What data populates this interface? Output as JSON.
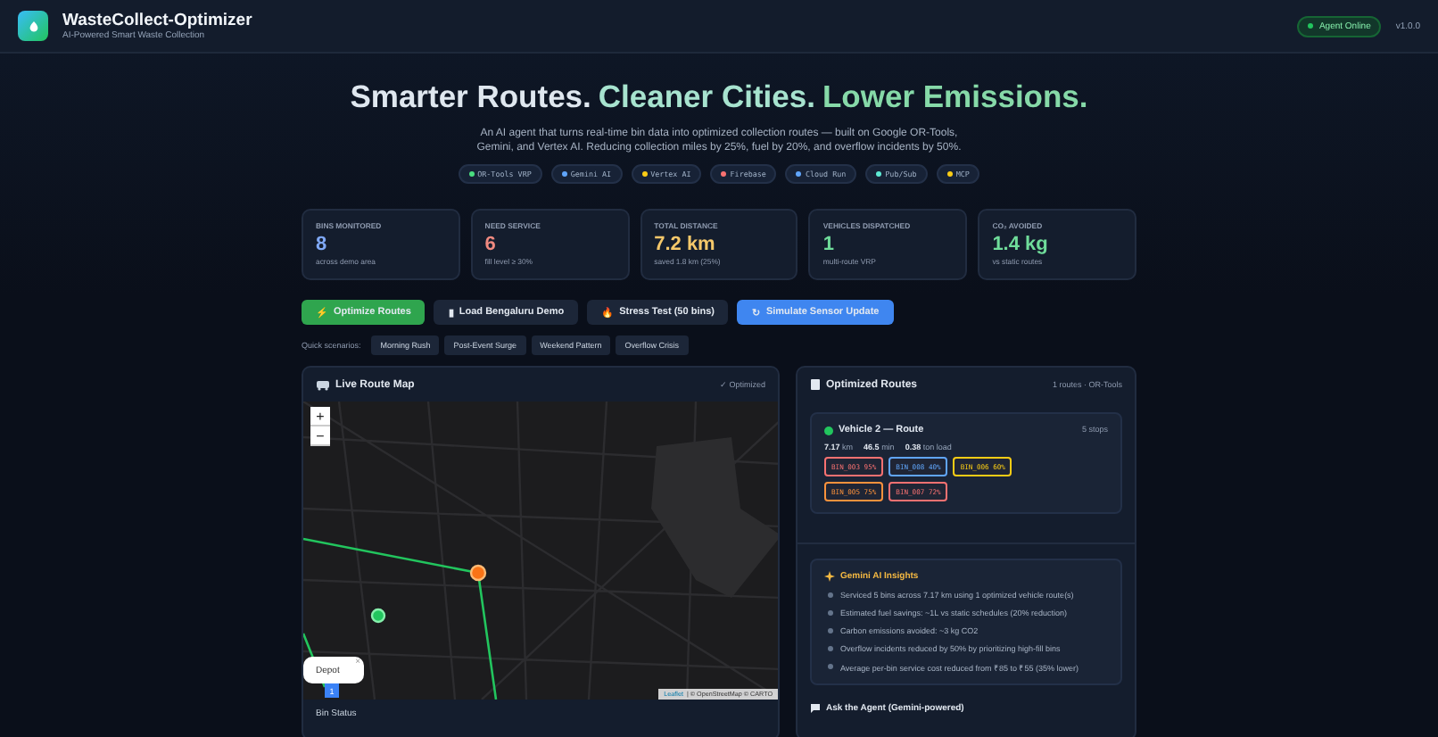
{
  "header": {
    "title": "WasteCollect-Optimizer",
    "subtitle": "AI-Powered Smart Waste Collection",
    "status": "Agent Online",
    "version": "v1.0.0"
  },
  "hero": {
    "title_parts": [
      {
        "text": "Smarter Routes.",
        "color": "#dfe7ef"
      },
      {
        "text": "Cleaner Cities.",
        "color": "#a7e3cf"
      },
      {
        "text": "Lower Emissions.",
        "color": "#86d9a8"
      }
    ],
    "description": "An AI agent that turns real-time bin data into optimized collection routes — built on Google OR-Tools, Gemini, and Vertex AI. Reducing collection miles by 25%, fuel by 20%, and overflow incidents by 50%.",
    "tech_chips": [
      {
        "label": "OR-Tools VRP",
        "color": "#4ade80"
      },
      {
        "label": "Gemini AI",
        "color": "#60a5fa"
      },
      {
        "label": "Vertex AI",
        "color": "#facc15"
      },
      {
        "label": "Firebase",
        "color": "#f87171"
      },
      {
        "label": "Cloud Run",
        "color": "#60a5fa"
      },
      {
        "label": "Pub/Sub",
        "color": "#5eead4"
      },
      {
        "label": "MCP",
        "color": "#facc15"
      }
    ]
  },
  "stats": [
    {
      "label": "BINS MONITORED",
      "value": "8",
      "note": "across demo area",
      "color": "#7fa8f5"
    },
    {
      "label": "NEED SERVICE",
      "value": "6",
      "note": "fill level ≥ 30%",
      "color": "#f08a80"
    },
    {
      "label": "TOTAL DISTANCE",
      "value": "7.2 km",
      "note": "saved 1.8 km (25%)",
      "color": "#f5c86a"
    },
    {
      "label": "VEHICLES DISPATCHED",
      "value": "1",
      "note": "multi-route VRP",
      "color": "#6fdc9a"
    },
    {
      "label": "CO₂ AVOIDED",
      "value": "1.4 kg",
      "note": "vs static routes",
      "color": "#6fdc9a"
    }
  ],
  "actions": [
    {
      "label": "Optimize Routes",
      "icon": "⚡",
      "kind": "success"
    },
    {
      "label": "Load Bengaluru Demo",
      "icon": "▮",
      "kind": "plain"
    },
    {
      "label": "Stress Test (50 bins)",
      "icon": "🔥",
      "kind": "plain"
    },
    {
      "label": "Simulate Sensor Update",
      "icon": "↻",
      "kind": "primary"
    }
  ],
  "quick_scenarios": {
    "label": "Quick scenarios:",
    "items": [
      "Morning Rush",
      "Post-Event Surge",
      "Weekend Pattern",
      "Overflow Crisis"
    ]
  },
  "map_panel": {
    "title": "Live Route Map",
    "status": "✓ Optimized",
    "zoom_in": "+",
    "zoom_out": "−",
    "popup": "Depot",
    "popup_close": "×",
    "depot_marker": "1",
    "attribution_link": "Leaflet",
    "attribution": "| © OpenStreetMap © CARTO",
    "footer": "Bin Status"
  },
  "routes_panel": {
    "title": "Optimized Routes",
    "meta": "1 routes · OR-Tools",
    "route": {
      "name": "Vehicle 2 — Route",
      "stops": "5 stops",
      "distance_value": "7.17",
      "distance_unit": "km",
      "time_value": "46.5",
      "time_unit": "min",
      "load_value": "0.38",
      "load_unit": "ton load",
      "bins": [
        {
          "label": "BIN_003 95%",
          "color": "#f87171"
        },
        {
          "label": "BIN_008 40%",
          "color": "#60a5fa"
        },
        {
          "label": "BIN_006 60%",
          "color": "#facc15"
        },
        {
          "label": "BIN_005 75%",
          "color": "#fb923c"
        },
        {
          "label": "BIN_007 72%",
          "color": "#f87171"
        }
      ]
    },
    "insights": {
      "title": "Gemini AI Insights",
      "items": [
        "Serviced 5 bins across 7.17 km using 1 optimized vehicle route(s)",
        "Estimated fuel savings: ~1L vs static schedules (20% reduction)",
        "Carbon emissions avoided: ~3 kg CO2",
        "Overflow incidents reduced by 50% by prioritizing high-fill bins",
        "Average per-bin service cost reduced from ₹85 to ₹55 (35% lower)"
      ]
    },
    "ask_title": "Ask the Agent (Gemini-powered)"
  }
}
